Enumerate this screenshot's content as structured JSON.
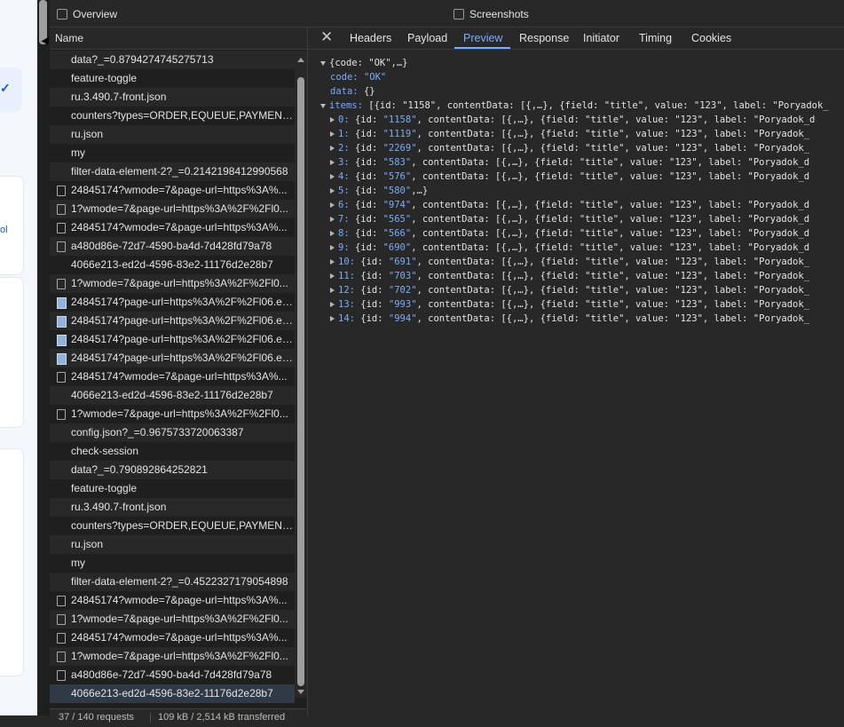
{
  "overview_label": "Overview",
  "screenshots_label": "Screenshots",
  "name_header": "Name",
  "requests": [
    {
      "name": "data?_=0.8794274745275713",
      "icon": "json"
    },
    {
      "name": "feature-toggle",
      "icon": "json"
    },
    {
      "name": "ru.3.490.7-front.json",
      "icon": "json"
    },
    {
      "name": "counters?types=ORDER,EQUEUE,PAYMENT,G...",
      "icon": "json"
    },
    {
      "name": "ru.json",
      "icon": "json"
    },
    {
      "name": "my",
      "icon": "json"
    },
    {
      "name": "filter-data-element-2?_=0.2142198412990568",
      "icon": "json"
    },
    {
      "name": "24845174?wmode=7&page-url=https%3A%...",
      "icon": "doc"
    },
    {
      "name": "1?wmode=7&page-url=https%3A%2F%2Fl0...",
      "icon": "doc"
    },
    {
      "name": "24845174?wmode=7&page-url=https%3A%...",
      "icon": "doc"
    },
    {
      "name": "a480d86e-72d7-4590-ba4d-7d428fd79a78",
      "icon": "doc"
    },
    {
      "name": "4066e213-ed2d-4596-83e2-11176d2e28b7",
      "icon": "json"
    },
    {
      "name": "1?wmode=7&page-url=https%3A%2F%2Fl0...",
      "icon": "doc"
    },
    {
      "name": "24845174?page-url=https%3A%2F%2Fl06.ep...",
      "icon": "img"
    },
    {
      "name": "24845174?page-url=https%3A%2F%2Fl06.ep...",
      "icon": "img"
    },
    {
      "name": "24845174?page-url=https%3A%2F%2Fl06.ep...",
      "icon": "img"
    },
    {
      "name": "24845174?page-url=https%3A%2F%2Fl06.ep...",
      "icon": "img"
    },
    {
      "name": "24845174?wmode=7&page-url=https%3A%...",
      "icon": "doc"
    },
    {
      "name": "4066e213-ed2d-4596-83e2-11176d2e28b7",
      "icon": "json"
    },
    {
      "name": "1?wmode=7&page-url=https%3A%2F%2Fl0...",
      "icon": "doc"
    },
    {
      "name": "config.json?_=0.9675733720063387",
      "icon": "json"
    },
    {
      "name": "check-session",
      "icon": "json"
    },
    {
      "name": "data?_=0.790892864252821",
      "icon": "json"
    },
    {
      "name": "feature-toggle",
      "icon": "json"
    },
    {
      "name": "ru.3.490.7-front.json",
      "icon": "json"
    },
    {
      "name": "counters?types=ORDER,EQUEUE,PAYMENT,G...",
      "icon": "json"
    },
    {
      "name": "ru.json",
      "icon": "json"
    },
    {
      "name": "my",
      "icon": "json"
    },
    {
      "name": "filter-data-element-2?_=0.4522327179054898",
      "icon": "json"
    },
    {
      "name": "24845174?wmode=7&page-url=https%3A%...",
      "icon": "doc"
    },
    {
      "name": "1?wmode=7&page-url=https%3A%2F%2Fl0...",
      "icon": "doc"
    },
    {
      "name": "24845174?wmode=7&page-url=https%3A%...",
      "icon": "doc"
    },
    {
      "name": "1?wmode=7&page-url=https%3A%2F%2Fl0...",
      "icon": "doc"
    },
    {
      "name": "a480d86e-72d7-4590-ba4d-7d428fd79a78",
      "icon": "doc"
    },
    {
      "name": "4066e213-ed2d-4596-83e2-11176d2e28b7",
      "icon": "json",
      "selected": true
    }
  ],
  "status": {
    "requests": "37 / 140 requests",
    "transferred": "109 kB / 2,514 kB transferred"
  },
  "tabs": [
    "Headers",
    "Payload",
    "Preview",
    "Response",
    "Initiator",
    "Timing",
    "Cookies"
  ],
  "active_tab": "Preview",
  "preview": {
    "root": "{code: \"OK\",…}",
    "code_key": "code:",
    "code_val": "\"OK\"",
    "data_key": "data:",
    "data_val": "{}",
    "items_key": "items:",
    "items_summary": "[{id: \"1158\", contentData: [{,…}, {field: \"title\", value: \"123\", label: \"Poryadok_",
    "items": [
      {
        "k": "0:",
        "id": "\"1158\"",
        "rest": ", contentData: [{,…}, {field: \"title\", value: \"123\", label: \"Poryadok_d"
      },
      {
        "k": "1:",
        "id": "\"1119\"",
        "rest": ", contentData: [{,…}, {field: \"title\", value: \"123\", label: \"Poryadok_"
      },
      {
        "k": "2:",
        "id": "\"2269\"",
        "rest": ", contentData: [{,…}, {field: \"title\", value: \"123\", label: \"Poryadok_"
      },
      {
        "k": "3:",
        "id": "\"583\"",
        "rest": ", contentData: [{,…}, {field: \"title\", value: \"123\", label: \"Poryadok_d"
      },
      {
        "k": "4:",
        "id": "\"576\"",
        "rest": ", contentData: [{,…}, {field: \"title\", value: \"123\", label: \"Poryadok_d"
      },
      {
        "k": "5:",
        "id": "\"580\"",
        "rest": ",…}"
      },
      {
        "k": "6:",
        "id": "\"974\"",
        "rest": ", contentData: [{,…}, {field: \"title\", value: \"123\", label: \"Poryadok_d"
      },
      {
        "k": "7:",
        "id": "\"565\"",
        "rest": ", contentData: [{,…}, {field: \"title\", value: \"123\", label: \"Poryadok_d"
      },
      {
        "k": "8:",
        "id": "\"566\"",
        "rest": ", contentData: [{,…}, {field: \"title\", value: \"123\", label: \"Poryadok_d"
      },
      {
        "k": "9:",
        "id": "\"690\"",
        "rest": ", contentData: [{,…}, {field: \"title\", value: \"123\", label: \"Poryadok_d"
      },
      {
        "k": "10:",
        "id": "\"691\"",
        "rest": ", contentData: [{,…}, {field: \"title\", value: \"123\", label: \"Poryadok_"
      },
      {
        "k": "11:",
        "id": "\"703\"",
        "rest": ", contentData: [{,…}, {field: \"title\", value: \"123\", label: \"Poryadok_"
      },
      {
        "k": "12:",
        "id": "\"702\"",
        "rest": ", contentData: [{,…}, {field: \"title\", value: \"123\", label: \"Poryadok_"
      },
      {
        "k": "13:",
        "id": "\"993\"",
        "rest": ", contentData: [{,…}, {field: \"title\", value: \"123\", label: \"Poryadok_"
      },
      {
        "k": "14:",
        "id": "\"994\"",
        "rest": ", contentData: [{,…}, {field: \"title\", value: \"123\", label: \"Poryadok_"
      }
    ]
  },
  "page_strip": {
    "check_glyph": "✓",
    "text_fragment": "ol"
  }
}
